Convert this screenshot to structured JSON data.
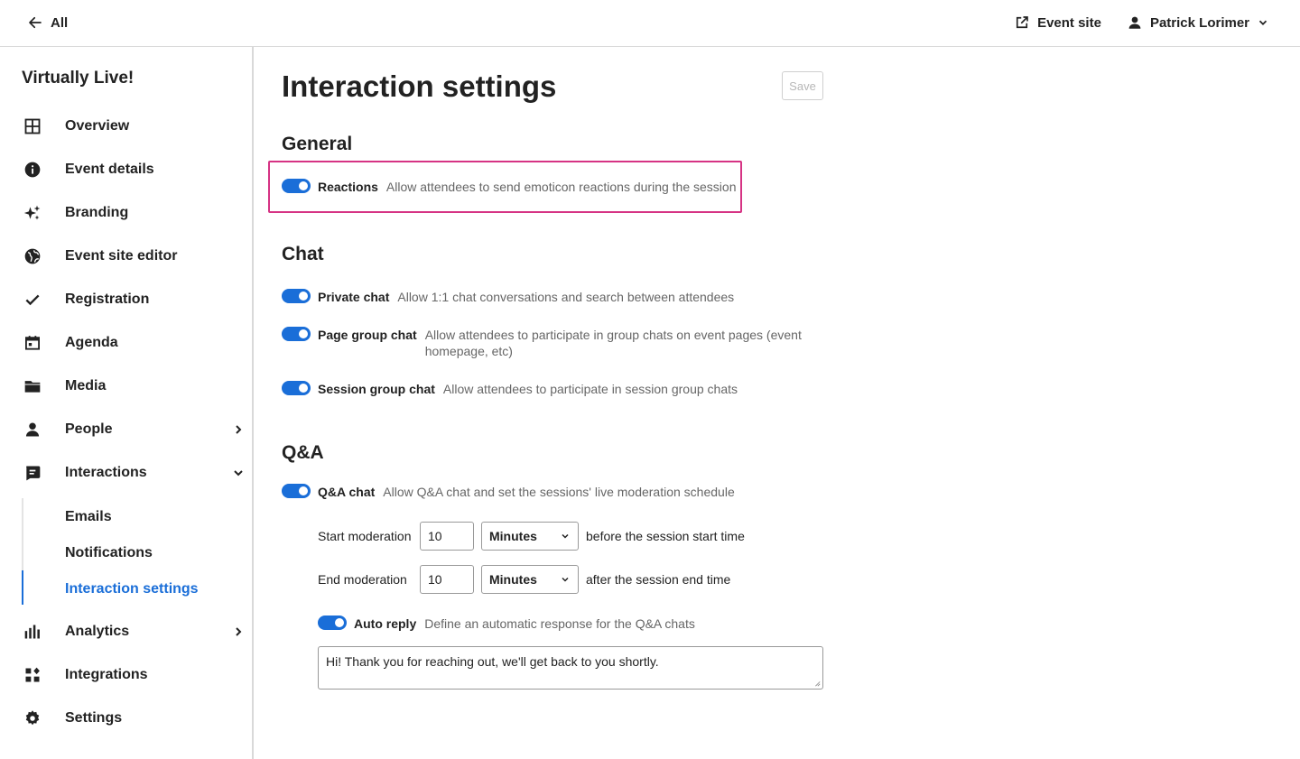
{
  "topbar": {
    "back_label": "All",
    "event_site_label": "Event site",
    "user_name": "Patrick Lorimer"
  },
  "sidebar": {
    "event_name": "Virtually Live!",
    "items": [
      {
        "label": "Overview",
        "icon": "grid-icon"
      },
      {
        "label": "Event details",
        "icon": "info-icon"
      },
      {
        "label": "Branding",
        "icon": "sparkle-icon"
      },
      {
        "label": "Event site editor",
        "icon": "globe-icon"
      },
      {
        "label": "Registration",
        "icon": "check-icon"
      },
      {
        "label": "Agenda",
        "icon": "calendar-icon"
      },
      {
        "label": "Media",
        "icon": "folder-icon"
      },
      {
        "label": "People",
        "icon": "person-icon"
      },
      {
        "label": "Interactions",
        "icon": "chat-icon"
      },
      {
        "label": "Analytics",
        "icon": "bar-chart-icon"
      },
      {
        "label": "Integrations",
        "icon": "apps-icon"
      },
      {
        "label": "Settings",
        "icon": "gear-icon"
      }
    ],
    "sub_items": [
      "Emails",
      "Notifications",
      "Interaction settings"
    ]
  },
  "main": {
    "title": "Interaction settings",
    "save_label": "Save",
    "general": {
      "title": "General",
      "reactions": {
        "name": "Reactions",
        "desc": "Allow attendees to send emoticon reactions during the session",
        "enabled": true
      }
    },
    "chat": {
      "title": "Chat",
      "private": {
        "name": "Private chat",
        "desc": "Allow 1:1 chat conversations and search between attendees",
        "enabled": true
      },
      "page_group": {
        "name": "Page group chat",
        "desc": "Allow attendees to participate in group chats on event pages (event homepage, etc)",
        "enabled": true
      },
      "session_group": {
        "name": "Session group chat",
        "desc": "Allow attendees to participate in session group chats",
        "enabled": true
      }
    },
    "qa": {
      "title": "Q&A",
      "qa_chat": {
        "name": "Q&A chat",
        "desc": "Allow Q&A chat and set the sessions' live moderation schedule",
        "enabled": true
      },
      "start": {
        "label": "Start moderation",
        "value": "10",
        "unit": "Minutes",
        "after": "before the session start time"
      },
      "end": {
        "label": "End moderation",
        "value": "10",
        "unit": "Minutes",
        "after": "after the session end time"
      },
      "auto_reply": {
        "name": "Auto reply",
        "desc": "Define an automatic response for the Q&A chats",
        "enabled": true,
        "message": "Hi! Thank you for reaching out, we'll get back to you shortly."
      }
    }
  },
  "colors": {
    "accent": "#1a6ed8",
    "highlight": "#d63384"
  }
}
